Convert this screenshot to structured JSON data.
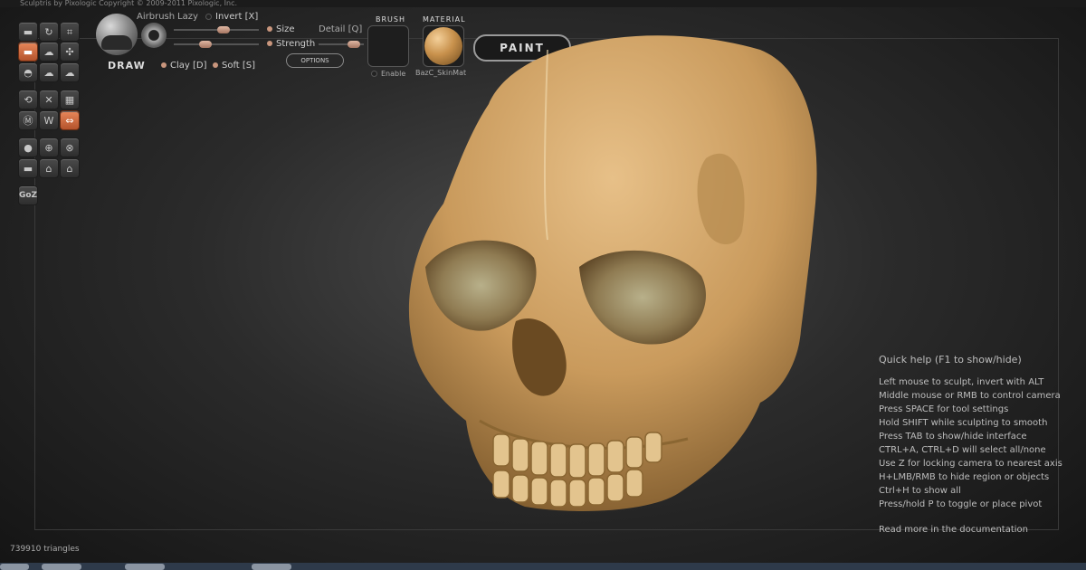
{
  "window": {
    "title": "Sculptris by Pixologic    Copyright © 2009-2011 Pixologic, Inc."
  },
  "toolbar": {
    "tool_name": "DRAW",
    "airbrush": "Airbrush",
    "lazy": "Lazy",
    "invert": "Invert [X]",
    "size": "Size",
    "strength": "Strength",
    "detail": "Detail [Q]",
    "options": "OPTIONS",
    "clay": "Clay [D]",
    "soft": "Soft [S]",
    "brush_header": "BRUSH",
    "material_header": "MATERIAL",
    "enable": "Enable",
    "material_name": "BazC_SkinMat",
    "paint": "PAINT",
    "goz": "GoZ"
  },
  "values": {
    "size": 0.6,
    "strength": 0.35,
    "detail": 0.9
  },
  "help": {
    "title": "Quick help (F1 to show/hide)",
    "lines": [
      "Left mouse to sculpt, invert with ALT",
      "Middle mouse or RMB to control camera",
      "Press SPACE for tool settings",
      "Hold SHIFT while sculpting to smooth",
      "Press TAB to show/hide interface",
      "CTRL+A, CTRL+D will select all/none",
      "Use Z for locking camera to nearest axis",
      "H+LMB/RMB to hide region or objects",
      "Ctrl+H to show all",
      "Press/hold P to toggle or place pivot"
    ],
    "more": "Read more in the documentation"
  },
  "status": {
    "triangles": "739910 triangles"
  },
  "colors": {
    "accent": "#d06a3c",
    "skull": "#c99a5c",
    "knob": "#c9967d"
  },
  "icons": [
    "draw-icon",
    "rotate-icon",
    "crop-icon",
    "flatten-icon",
    "crease-icon",
    "move-icon",
    "inflate-icon",
    "pinch-icon",
    "grab-icon",
    "symmetry-icon",
    "wireframe-icon",
    "grid-icon",
    "reduce-icon",
    "mask-icon",
    "scale-icon",
    "sphere-icon",
    "subdivide-icon",
    "paint-icon",
    "import-icon",
    "export-icon",
    "save-icon"
  ]
}
